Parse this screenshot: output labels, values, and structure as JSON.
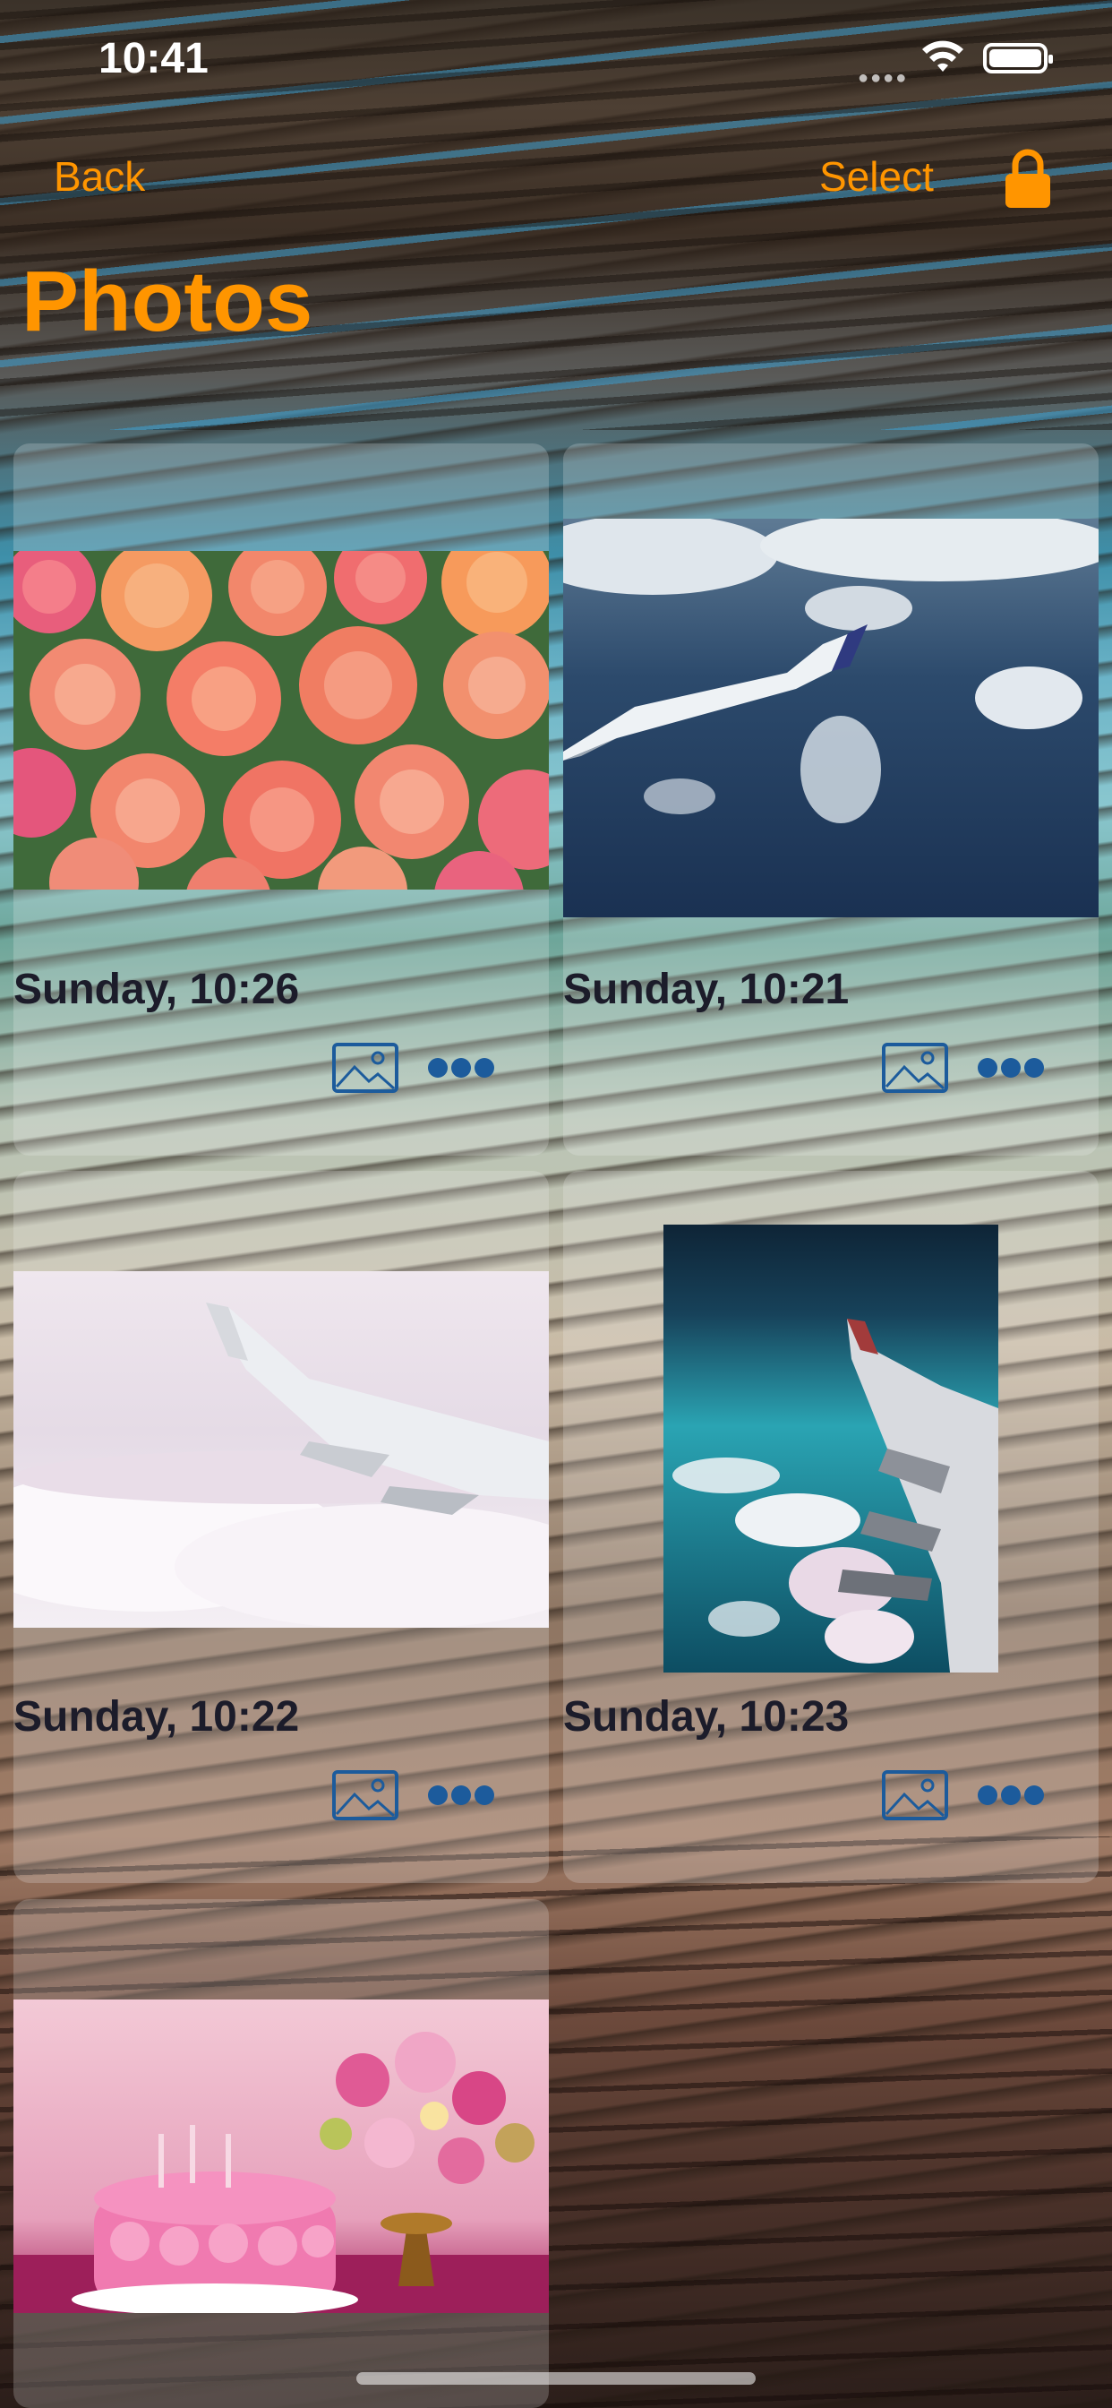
{
  "status": {
    "time": "10:41"
  },
  "nav": {
    "back_label": "Back",
    "select_label": "Select"
  },
  "page": {
    "title": "Photos"
  },
  "colors": {
    "accent": "#ff9500",
    "icon_blue": "#1c5b9c"
  },
  "cards": [
    {
      "date": "Sunday, 10:26",
      "photo": "roses"
    },
    {
      "date": "Sunday, 10:21",
      "photo": "airplane-wing-over-ocean"
    },
    {
      "date": "Sunday, 10:22",
      "photo": "airplane-wing-above-clouds"
    },
    {
      "date": "Sunday, 10:23",
      "photo": "airplane-wing-over-sea"
    },
    {
      "photo": "pink-birthday-cake-with-flowers"
    }
  ]
}
